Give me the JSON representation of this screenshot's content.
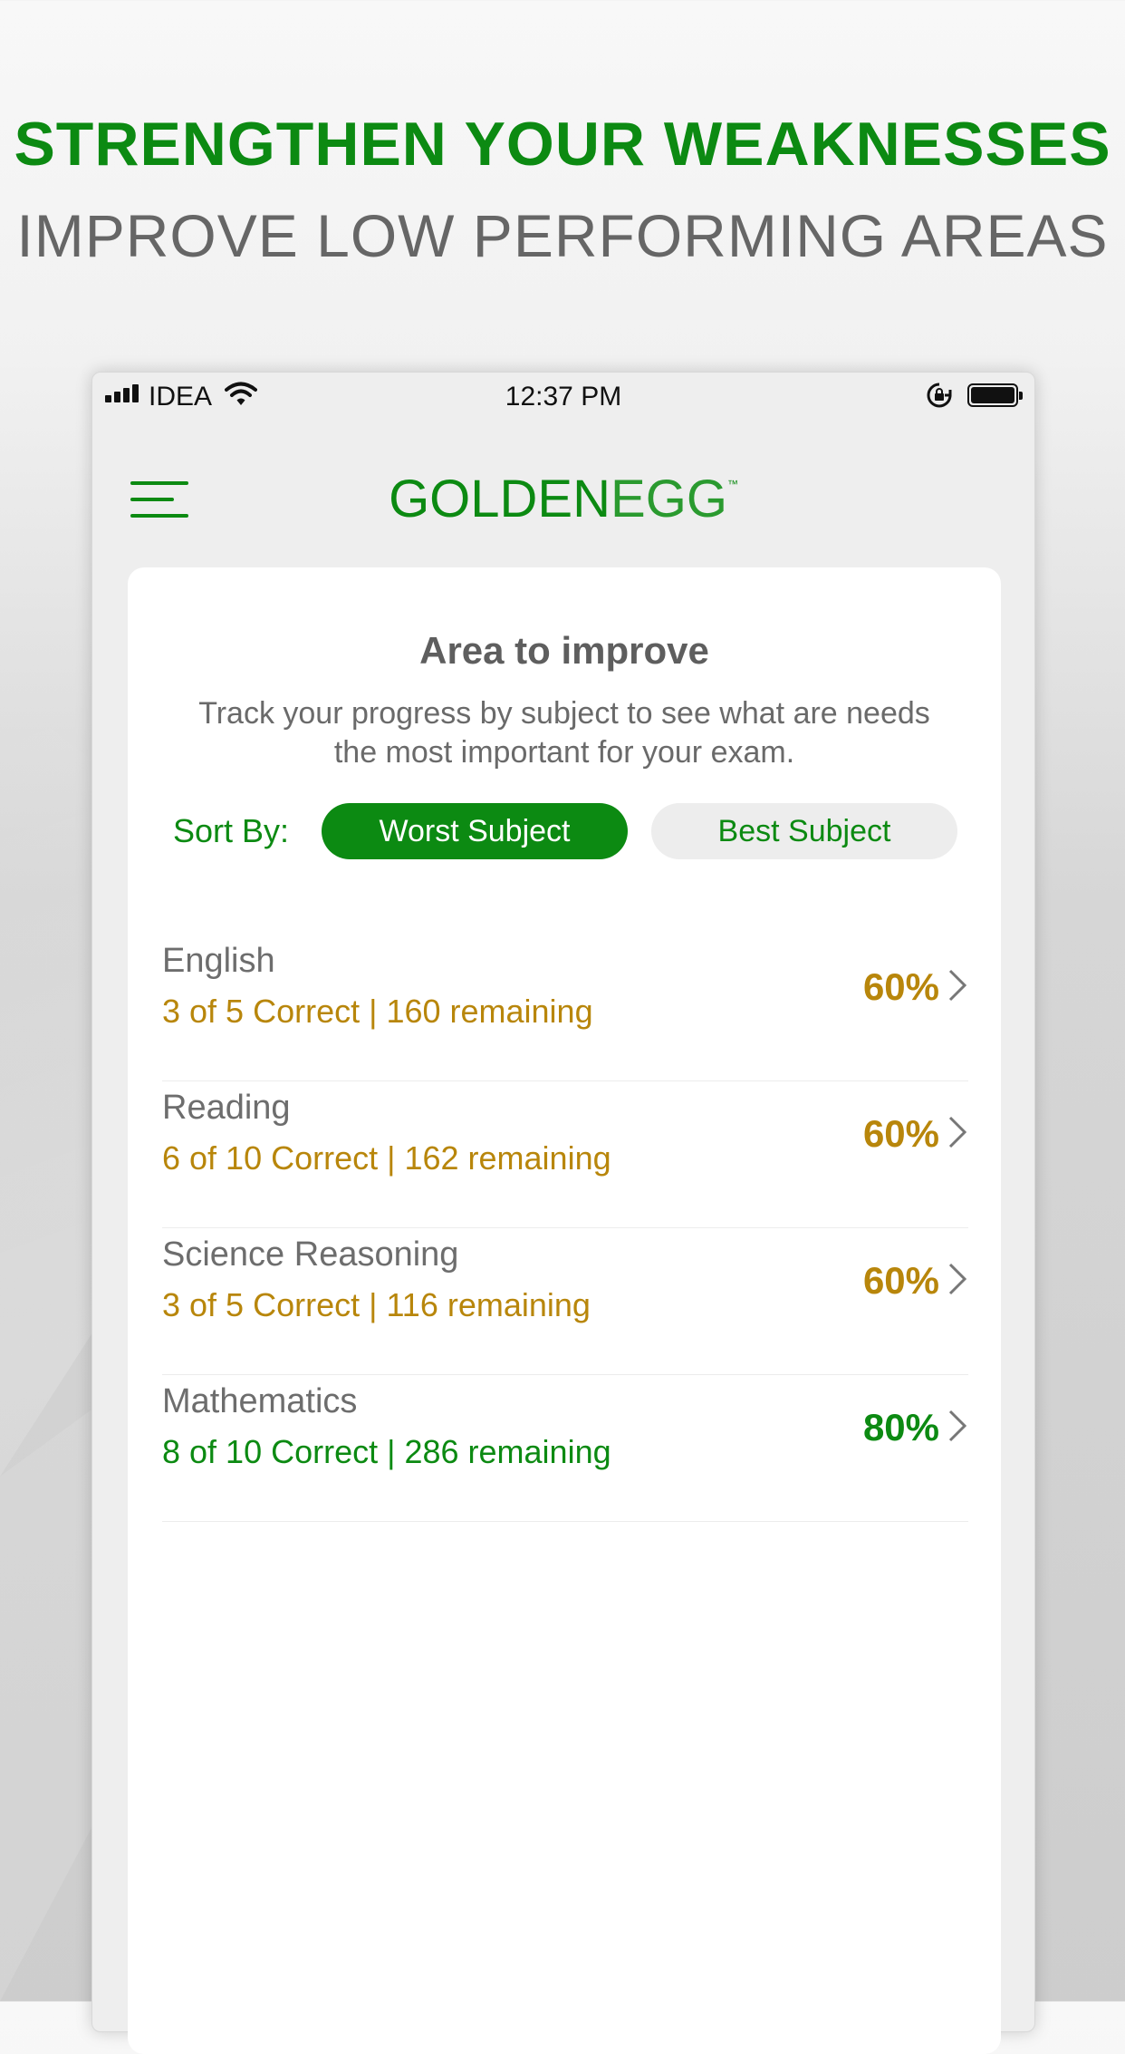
{
  "promo": {
    "headline": "STRENGTHEN YOUR WEAKNESSES",
    "subheadline": "IMPROVE LOW PERFORMING AREAS"
  },
  "status_bar": {
    "carrier": "IDEA",
    "time": "12:37 PM"
  },
  "header": {
    "logo_part1": "GOLDEN",
    "logo_part2": "EGG",
    "logo_tm": "™"
  },
  "card": {
    "title": "Area to improve",
    "description": "Track your progress by subject to see what are needs the most important for your exam.",
    "sort_label": "Sort By:",
    "sort_options": {
      "worst": "Worst Subject",
      "best": "Best Subject"
    }
  },
  "colors": {
    "brand_green": "#0c8a12",
    "warning_gold": "#b8860b"
  },
  "subjects": [
    {
      "name": "English",
      "stats": "3 of 5  Correct | 160 remaining",
      "percent": "60%",
      "color": "#b8860b"
    },
    {
      "name": "Reading",
      "stats": "6 of 10  Correct | 162 remaining",
      "percent": "60%",
      "color": "#b8860b"
    },
    {
      "name": "Science Reasoning",
      "stats": "3 of 5  Correct | 116 remaining",
      "percent": "60%",
      "color": "#b8860b"
    },
    {
      "name": "Mathematics",
      "stats": "8 of 10  Correct | 286 remaining",
      "percent": "80%",
      "color": "#0c8a12"
    }
  ]
}
